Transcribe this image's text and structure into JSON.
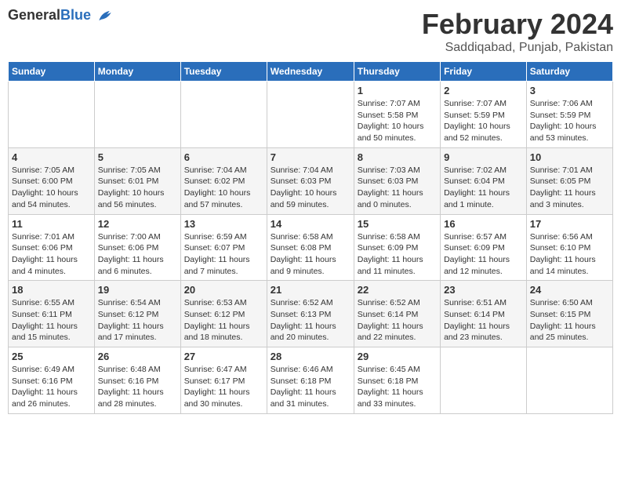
{
  "header": {
    "logo_general": "General",
    "logo_blue": "Blue",
    "month_title": "February 2024",
    "location": "Saddiqabad, Punjab, Pakistan"
  },
  "calendar": {
    "days_of_week": [
      "Sunday",
      "Monday",
      "Tuesday",
      "Wednesday",
      "Thursday",
      "Friday",
      "Saturday"
    ],
    "weeks": [
      [
        {
          "day": "",
          "info": ""
        },
        {
          "day": "",
          "info": ""
        },
        {
          "day": "",
          "info": ""
        },
        {
          "day": "",
          "info": ""
        },
        {
          "day": "1",
          "info": "Sunrise: 7:07 AM\nSunset: 5:58 PM\nDaylight: 10 hours\nand 50 minutes."
        },
        {
          "day": "2",
          "info": "Sunrise: 7:07 AM\nSunset: 5:59 PM\nDaylight: 10 hours\nand 52 minutes."
        },
        {
          "day": "3",
          "info": "Sunrise: 7:06 AM\nSunset: 5:59 PM\nDaylight: 10 hours\nand 53 minutes."
        }
      ],
      [
        {
          "day": "4",
          "info": "Sunrise: 7:05 AM\nSunset: 6:00 PM\nDaylight: 10 hours\nand 54 minutes."
        },
        {
          "day": "5",
          "info": "Sunrise: 7:05 AM\nSunset: 6:01 PM\nDaylight: 10 hours\nand 56 minutes."
        },
        {
          "day": "6",
          "info": "Sunrise: 7:04 AM\nSunset: 6:02 PM\nDaylight: 10 hours\nand 57 minutes."
        },
        {
          "day": "7",
          "info": "Sunrise: 7:04 AM\nSunset: 6:03 PM\nDaylight: 10 hours\nand 59 minutes."
        },
        {
          "day": "8",
          "info": "Sunrise: 7:03 AM\nSunset: 6:03 PM\nDaylight: 11 hours\nand 0 minutes."
        },
        {
          "day": "9",
          "info": "Sunrise: 7:02 AM\nSunset: 6:04 PM\nDaylight: 11 hours\nand 1 minute."
        },
        {
          "day": "10",
          "info": "Sunrise: 7:01 AM\nSunset: 6:05 PM\nDaylight: 11 hours\nand 3 minutes."
        }
      ],
      [
        {
          "day": "11",
          "info": "Sunrise: 7:01 AM\nSunset: 6:06 PM\nDaylight: 11 hours\nand 4 minutes."
        },
        {
          "day": "12",
          "info": "Sunrise: 7:00 AM\nSunset: 6:06 PM\nDaylight: 11 hours\nand 6 minutes."
        },
        {
          "day": "13",
          "info": "Sunrise: 6:59 AM\nSunset: 6:07 PM\nDaylight: 11 hours\nand 7 minutes."
        },
        {
          "day": "14",
          "info": "Sunrise: 6:58 AM\nSunset: 6:08 PM\nDaylight: 11 hours\nand 9 minutes."
        },
        {
          "day": "15",
          "info": "Sunrise: 6:58 AM\nSunset: 6:09 PM\nDaylight: 11 hours\nand 11 minutes."
        },
        {
          "day": "16",
          "info": "Sunrise: 6:57 AM\nSunset: 6:09 PM\nDaylight: 11 hours\nand 12 minutes."
        },
        {
          "day": "17",
          "info": "Sunrise: 6:56 AM\nSunset: 6:10 PM\nDaylight: 11 hours\nand 14 minutes."
        }
      ],
      [
        {
          "day": "18",
          "info": "Sunrise: 6:55 AM\nSunset: 6:11 PM\nDaylight: 11 hours\nand 15 minutes."
        },
        {
          "day": "19",
          "info": "Sunrise: 6:54 AM\nSunset: 6:12 PM\nDaylight: 11 hours\nand 17 minutes."
        },
        {
          "day": "20",
          "info": "Sunrise: 6:53 AM\nSunset: 6:12 PM\nDaylight: 11 hours\nand 18 minutes."
        },
        {
          "day": "21",
          "info": "Sunrise: 6:52 AM\nSunset: 6:13 PM\nDaylight: 11 hours\nand 20 minutes."
        },
        {
          "day": "22",
          "info": "Sunrise: 6:52 AM\nSunset: 6:14 PM\nDaylight: 11 hours\nand 22 minutes."
        },
        {
          "day": "23",
          "info": "Sunrise: 6:51 AM\nSunset: 6:14 PM\nDaylight: 11 hours\nand 23 minutes."
        },
        {
          "day": "24",
          "info": "Sunrise: 6:50 AM\nSunset: 6:15 PM\nDaylight: 11 hours\nand 25 minutes."
        }
      ],
      [
        {
          "day": "25",
          "info": "Sunrise: 6:49 AM\nSunset: 6:16 PM\nDaylight: 11 hours\nand 26 minutes."
        },
        {
          "day": "26",
          "info": "Sunrise: 6:48 AM\nSunset: 6:16 PM\nDaylight: 11 hours\nand 28 minutes."
        },
        {
          "day": "27",
          "info": "Sunrise: 6:47 AM\nSunset: 6:17 PM\nDaylight: 11 hours\nand 30 minutes."
        },
        {
          "day": "28",
          "info": "Sunrise: 6:46 AM\nSunset: 6:18 PM\nDaylight: 11 hours\nand 31 minutes."
        },
        {
          "day": "29",
          "info": "Sunrise: 6:45 AM\nSunset: 6:18 PM\nDaylight: 11 hours\nand 33 minutes."
        },
        {
          "day": "",
          "info": ""
        },
        {
          "day": "",
          "info": ""
        }
      ]
    ]
  }
}
